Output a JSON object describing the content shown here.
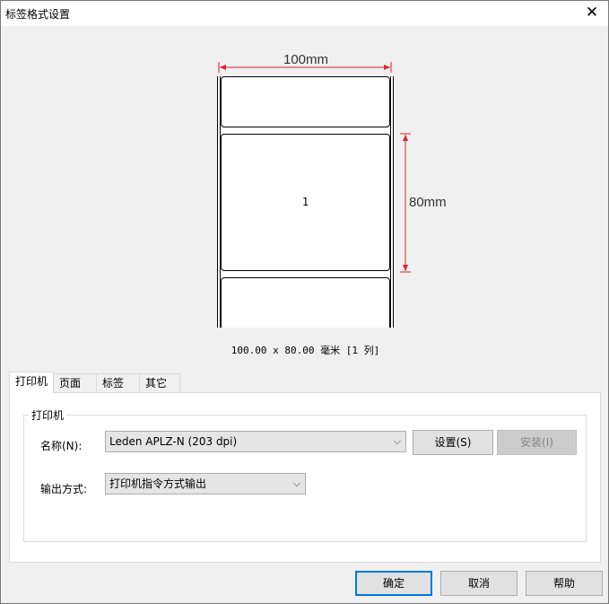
{
  "window": {
    "title": "标签格式设置"
  },
  "preview": {
    "width_label": "100mm",
    "height_label": "80mm",
    "label_number": "1",
    "size_summary": "100.00 x 80.00 毫米 [1 列]"
  },
  "tabs": [
    {
      "label": "打印机",
      "active": true
    },
    {
      "label": "页面",
      "active": false
    },
    {
      "label": "标签",
      "active": false
    },
    {
      "label": "其它",
      "active": false
    }
  ],
  "printer_group": {
    "legend": "打印机",
    "name_label": "名称(N):",
    "name_value": "Leden APLZ-N (203 dpi)",
    "setup_label": "设置(S)",
    "install_label": "安装(I)",
    "output_label": "输出方式:",
    "output_value": "打印机指令方式输出"
  },
  "footer": {
    "ok_label": "确定",
    "cancel_label": "取消",
    "help_label": "帮助"
  },
  "colors": {
    "dimension": "#e0202a",
    "focus": "#0078d7"
  }
}
